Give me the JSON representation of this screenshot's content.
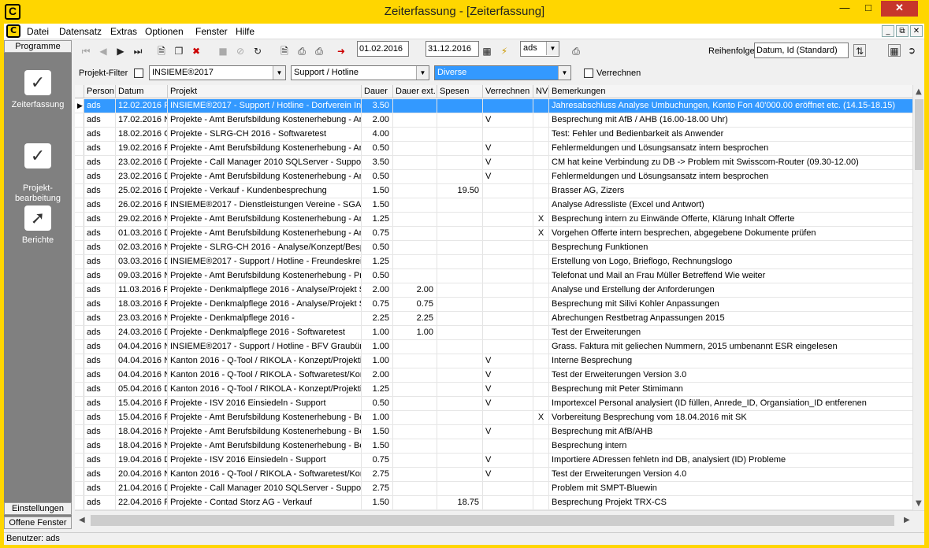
{
  "window": {
    "title": "Zeiterfassung - [Zeiterfassung]"
  },
  "menu": [
    "Datei",
    "Datensatz",
    "Extras",
    "Optionen",
    "Fenster",
    "Hilfe"
  ],
  "sidebar": {
    "top_label": "Programme",
    "items": [
      {
        "label": "Zeiterfassung",
        "icon": "clipboard-check-icon"
      },
      {
        "label": "Projekt-\nbearbeitung",
        "icon": "clipboard-check-icon"
      },
      {
        "label": "Berichte",
        "icon": "chart-icon"
      }
    ],
    "bottom_buttons": [
      "Einstellungen",
      "Offene Fenster"
    ]
  },
  "toolbar": {
    "date_from": "01.02.2016",
    "date_to": "31.12.2016",
    "user": "ads",
    "sort_label": "Reihenfolge",
    "sort_value": "Datum, Id (Standard)"
  },
  "filter": {
    "project_filter_label": "Projekt-Filter",
    "project": "INSIEME®2017",
    "subproject": "Support / Hotline",
    "activity": "Diverse",
    "bill_label": "Verrechnen"
  },
  "table": {
    "columns": [
      "Person",
      "Datum",
      "Projekt",
      "Dauer",
      "Dauer ext.",
      "Spesen",
      "Verrechnen",
      "NV",
      "Bemerkungen"
    ],
    "rows": [
      [
        "ads",
        "12.02.2016 F",
        "INSIEME®2017 - Support / Hotline - Dorfverein Ins",
        "3.50",
        "",
        "",
        "",
        "",
        "Jahresabschluss Analyse Umbuchungen, Konto Fon 40'000.00 eröffnet etc. (14.15-18.15)"
      ],
      [
        "ads",
        "17.02.2016 N",
        "Projekte - Amt Berufsbildung Kostenerhebung - Ana",
        "2.00",
        "",
        "",
        "V",
        "",
        "Besprechung mit AfB / AHB (16.00-18.00 Uhr)"
      ],
      [
        "ads",
        "18.02.2016 C",
        "Projekte - SLRG-CH 2016 - Softwaretest",
        "4.00",
        "",
        "",
        "",
        "",
        "Test: Fehler und Bedienbarkeit als Anwender"
      ],
      [
        "ads",
        "19.02.2016 F",
        "Projekte - Amt Berufsbildung Kostenerhebung - Ana",
        "0.50",
        "",
        "",
        "V",
        "",
        "Fehlermeldungen und Lösungsansatz  intern besprochen"
      ],
      [
        "ads",
        "23.02.2016 D",
        "Projekte - Call Manager 2010 SQLServer - Support",
        "3.50",
        "",
        "",
        "V",
        "",
        "CM hat keine Verbindung zu DB -> Problem mit Swisscom-Router (09.30-12.00)"
      ],
      [
        "ads",
        "23.02.2016 D",
        "Projekte - Amt Berufsbildung Kostenerhebung - Ana",
        "0.50",
        "",
        "",
        "V",
        "",
        "Fehlermeldungen und Lösungsansatz  intern besprochen"
      ],
      [
        "ads",
        "25.02.2016 D",
        "Projekte - Verkauf - Kundenbesprechung",
        "1.50",
        "",
        "19.50",
        "",
        "",
        "Brasser AG, Zizers"
      ],
      [
        "ads",
        "26.02.2016 F",
        "INSIEME®2017 - Dienstleistungen Vereine - SGA G",
        "1.50",
        "",
        "",
        "",
        "",
        "Analyse Adressliste (Excel und Antwort)"
      ],
      [
        "ads",
        "29.02.2016 N",
        "Projekte - Amt Berufsbildung Kostenerhebung - Ana",
        "1.25",
        "",
        "",
        "",
        "X",
        "Besprechung intern zu Einwände Offerte, Klärung Inhalt Offerte"
      ],
      [
        "ads",
        "01.03.2016 D",
        "Projekte - Amt Berufsbildung Kostenerhebung - Ana",
        "0.75",
        "",
        "",
        "",
        "X",
        "Vorgehen Offerte intern besprechen, abgegebene Dokumente prüfen"
      ],
      [
        "ads",
        "02.03.2016 N",
        "Projekte - SLRG-CH 2016 - Analyse/Konzept/Besp",
        "0.50",
        "",
        "",
        "",
        "",
        "Besprechung Funktionen"
      ],
      [
        "ads",
        "03.03.2016 D",
        "INSIEME®2017 - Support / Hotline - Freundeskreis",
        "1.25",
        "",
        "",
        "",
        "",
        "Erstellung von Logo, Brieflogo, Rechnungslogo"
      ],
      [
        "ads",
        "09.03.2016 N",
        "Projekte - Amt Berufsbildung Kostenerhebung - Proj",
        "0.50",
        "",
        "",
        "",
        "",
        "Telefonat und Mail an Frau Müller Betreffend Wie weiter"
      ],
      [
        "ads",
        "11.03.2016 F",
        "Projekte - Denkmalpflege 2016 - Analyse/Projekt Si",
        "2.00",
        "2.00",
        "",
        "",
        "",
        "Analyse und Erstellung der Anforderungen"
      ],
      [
        "ads",
        "18.03.2016 F",
        "Projekte - Denkmalpflege 2016 - Analyse/Projekt Si",
        "0.75",
        "0.75",
        "",
        "",
        "",
        "Besprechung mit Silivi Kohler Anpassungen"
      ],
      [
        "ads",
        "23.03.2016 N",
        "Projekte - Denkmalpflege 2016 -",
        "2.25",
        "2.25",
        "",
        "",
        "",
        "Abrechungen Restbetrag Anpassungen 2015"
      ],
      [
        "ads",
        "24.03.2016 D",
        "Projekte - Denkmalpflege 2016 - Softwaretest",
        "1.00",
        "1.00",
        "",
        "",
        "",
        "Test der Erweiterungen"
      ],
      [
        "ads",
        "04.04.2016 N",
        "INSIEME®2017 - Support / Hotline - BFV Graubünd",
        "1.00",
        "",
        "",
        "",
        "",
        "Grass. Faktura mit geliechen Nummern, 2015 umbenannt ESR eingelesen"
      ],
      [
        "ads",
        "04.04.2016 N",
        "Kanton 2016 - Q-Tool / RIKOLA - Konzept/Projektir",
        "1.00",
        "",
        "",
        "V",
        "",
        "Interne Besprechung"
      ],
      [
        "ads",
        "04.04.2016 N",
        "Kanton 2016 - Q-Tool / RIKOLA - Softwaretest/Kor",
        "2.00",
        "",
        "",
        "V",
        "",
        "Test der Erweiterungen Version 3.0"
      ],
      [
        "ads",
        "05.04.2016 D",
        "Kanton 2016 - Q-Tool / RIKOLA - Konzept/Projektir",
        "1.25",
        "",
        "",
        "V",
        "",
        "Besprechung mit Peter Stimimann"
      ],
      [
        "ads",
        "15.04.2016 F",
        "Projekte - ISV 2016 Einsiedeln - Support",
        "0.50",
        "",
        "",
        "V",
        "",
        "Importexcel Personal analysiert (ID füllen, Anrede_ID, Organsiation_ID entferenen"
      ],
      [
        "ads",
        "15.04.2016 F",
        "Projekte - Amt Berufsbildung Kostenerhebung - Bes",
        "1.00",
        "",
        "",
        "",
        "X",
        "Vorbereitung Besprechung vom 18.04.2016 mit SK"
      ],
      [
        "ads",
        "18.04.2016 N",
        "Projekte - Amt Berufsbildung Kostenerhebung - Bes",
        "1.50",
        "",
        "",
        "V",
        "",
        "Besprechung mit AfB/AHB"
      ],
      [
        "ads",
        "18.04.2016 N",
        "Projekte - Amt Berufsbildung Kostenerhebung - Bes",
        "1.50",
        "",
        "",
        "",
        "",
        "Besprechung intern"
      ],
      [
        "ads",
        "19.04.2016 D",
        "Projekte - ISV 2016 Einsiedeln - Support",
        "0.75",
        "",
        "",
        "V",
        "",
        "Importiere ADressen fehletn ind DB, analysiert (ID) Probleme"
      ],
      [
        "ads",
        "20.04.2016 N",
        "Kanton 2016 - Q-Tool / RIKOLA - Softwaretest/Kor",
        "2.75",
        "",
        "",
        "V",
        "",
        "Test der Erweiterungen Version 4.0"
      ],
      [
        "ads",
        "21.04.2016 D",
        "Projekte - Call Manager 2010 SQLServer - Support",
        "2.75",
        "",
        "",
        "",
        "",
        "Problem mit SMPT-Bluewin"
      ],
      [
        "ads",
        "22.04.2016 F",
        "Projekte - Contad Storz AG - Verkauf",
        "1.50",
        "",
        "18.75",
        "",
        "",
        "Besprechung Projekt TRX-CS"
      ]
    ]
  },
  "status": {
    "text": "Benutzer: ads"
  }
}
